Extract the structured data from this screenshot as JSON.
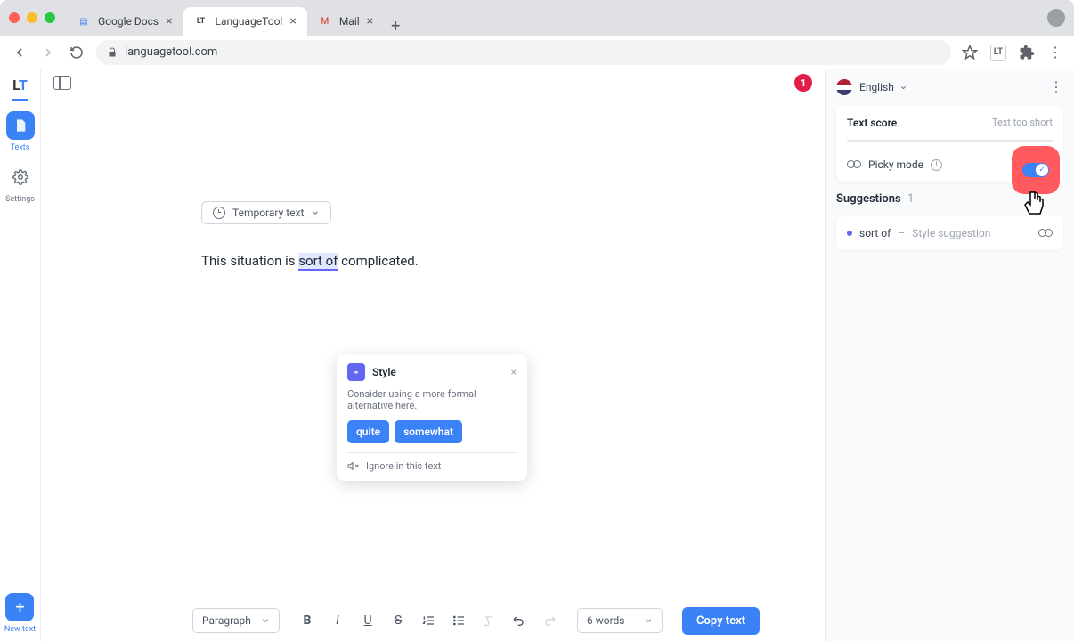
{
  "browser": {
    "tabs": [
      {
        "label": "Google Docs",
        "favicon": "📄"
      },
      {
        "label": "LanguageTool",
        "favicon": "LT"
      },
      {
        "label": "Mail",
        "favicon": "✉"
      }
    ],
    "url": "languagetool.com"
  },
  "rail": {
    "texts_label": "Texts",
    "settings_label": "Settings",
    "new_text_label": "New text"
  },
  "editor": {
    "error_count": "1",
    "doc_title": "Temporary text",
    "sentence_pre": "This situation is ",
    "sentence_hl": "sort of",
    "sentence_post": " complicated."
  },
  "popup": {
    "badge_label": "Style",
    "description": "Consider using a more formal alternative here.",
    "suggestion1": "quite",
    "suggestion2": "somewhat",
    "ignore_label": "Ignore in this text"
  },
  "bottombar": {
    "style_dropdown": "Paragraph",
    "words_dropdown": "6 words",
    "copy_label": "Copy text"
  },
  "panel": {
    "language": "English",
    "score_title": "Text score",
    "score_status": "Text too short",
    "picky_label": "Picky mode",
    "suggestions_title": "Suggestions",
    "suggestions_count": "1",
    "item_phrase": "sort of",
    "item_dash": "–",
    "item_type": "Style suggestion"
  }
}
